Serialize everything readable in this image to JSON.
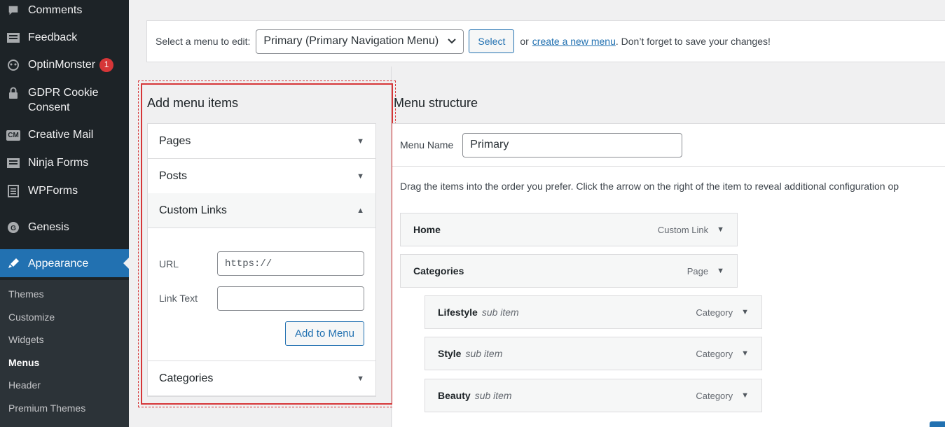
{
  "sidebar": {
    "items": [
      {
        "label": "Comments",
        "icon": "comment-icon"
      },
      {
        "label": "Feedback",
        "icon": "feedback-icon"
      },
      {
        "label": "OptinMonster",
        "icon": "optinmonster-icon",
        "badge": "1"
      },
      {
        "label": "GDPR Cookie Consent",
        "icon": "lock-icon"
      },
      {
        "label": "Creative Mail",
        "icon": "cm-icon",
        "icon_text": "CM"
      },
      {
        "label": "Ninja Forms",
        "icon": "forms-icon"
      },
      {
        "label": "WPForms",
        "icon": "wpforms-icon"
      },
      {
        "label": "Genesis",
        "icon": "genesis-icon"
      },
      {
        "label": "Appearance",
        "icon": "appearance-icon",
        "active": true
      }
    ],
    "submenu": [
      "Themes",
      "Customize",
      "Widgets",
      "Menus",
      "Header",
      "Premium Themes"
    ],
    "current_submenu": "Menus"
  },
  "topbar": {
    "prompt": "Select a menu to edit:",
    "selected_menu": "Primary (Primary Navigation Menu)",
    "select_button": "Select",
    "or_text": "or",
    "create_link": "create a new menu",
    "suffix": ". Don’t forget to save your changes!"
  },
  "add_items": {
    "title": "Add menu items",
    "sections": [
      {
        "label": "Pages",
        "open": false
      },
      {
        "label": "Posts",
        "open": false
      },
      {
        "label": "Custom Links",
        "open": true
      },
      {
        "label": "Categories",
        "open": false
      }
    ],
    "custom_links": {
      "url_label": "URL",
      "url_value": "https://",
      "link_text_label": "Link Text",
      "link_text_value": "",
      "add_button": "Add to Menu"
    }
  },
  "structure": {
    "title": "Menu structure",
    "menu_name_label": "Menu Name",
    "menu_name_value": "Primary",
    "instruction": "Drag the items into the order you prefer. Click the arrow on the right of the item to reveal additional configuration op",
    "items": [
      {
        "title": "Home",
        "sub": "",
        "type": "Custom Link",
        "depth": 0
      },
      {
        "title": "Categories",
        "sub": "",
        "type": "Page",
        "depth": 0
      },
      {
        "title": "Lifestyle",
        "sub": "sub item",
        "type": "Category",
        "depth": 1
      },
      {
        "title": "Style",
        "sub": "sub item",
        "type": "Category",
        "depth": 1
      },
      {
        "title": "Beauty",
        "sub": "sub item",
        "type": "Category",
        "depth": 1
      }
    ]
  },
  "colors": {
    "sidebar_bg": "#1d2327",
    "accent": "#2271b1",
    "badge": "#d63638",
    "highlight": "#d63638"
  }
}
